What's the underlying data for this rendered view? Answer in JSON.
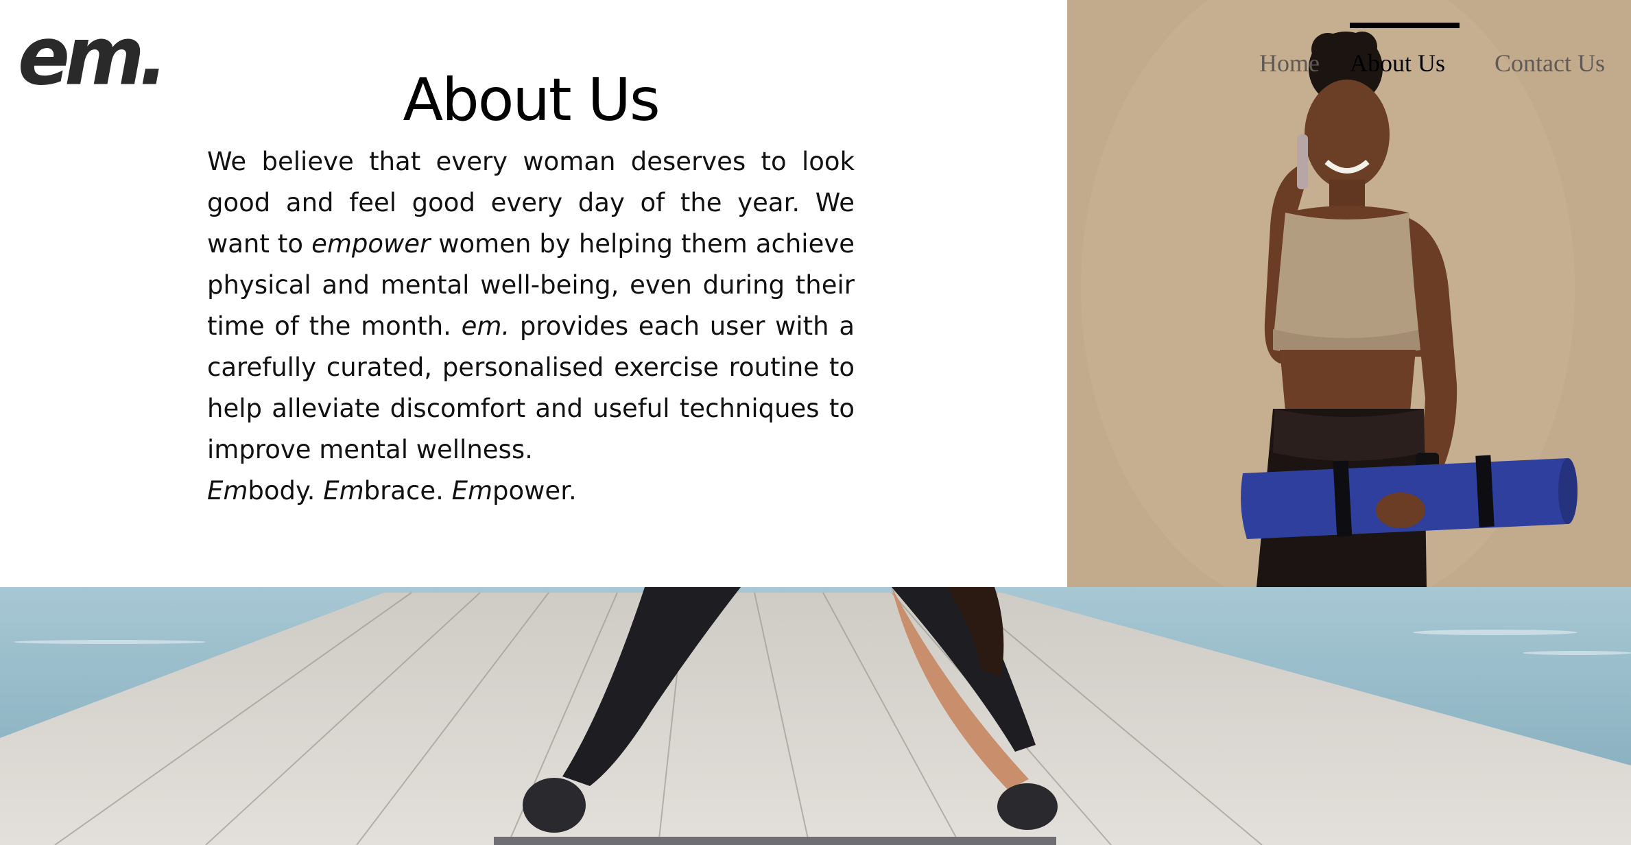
{
  "logo": {
    "text": "em."
  },
  "nav": {
    "items": [
      {
        "label": "Home",
        "active": false
      },
      {
        "label": "About Us",
        "active": true
      },
      {
        "label": "Contact Us",
        "active": false
      }
    ]
  },
  "about": {
    "title": "About Us",
    "paragraph": {
      "part1": "We believe that every woman deserves to look good and feel good every day of the year. We want to ",
      "emphasis1": "empower",
      "part2": " women by helping them achieve physical and mental well-being, even during their time of the month. ",
      "emphasis2": "em.",
      "part3": " provides each user with a carefully curated, personalised exercise routine to help alleviate discomfort and useful techniques to improve mental wellness."
    },
    "tagline": {
      "em1": "Em",
      "rest1": "body. ",
      "em2": "Em",
      "rest2": "brace. ",
      "em3": "Em",
      "rest3": "power."
    }
  },
  "images": {
    "hero": {
      "icon": "woman-with-yoga-mat-photo"
    },
    "bottom": {
      "icon": "woman-stretching-on-pier-photo"
    }
  },
  "colors": {
    "hero_background": "#c1aa8b",
    "nav_active": "#000000",
    "nav_inactive": "#5f5a55",
    "mat": "#2f3f9e",
    "sea": "#8fb7c8",
    "pier": "#d8d5d0"
  }
}
